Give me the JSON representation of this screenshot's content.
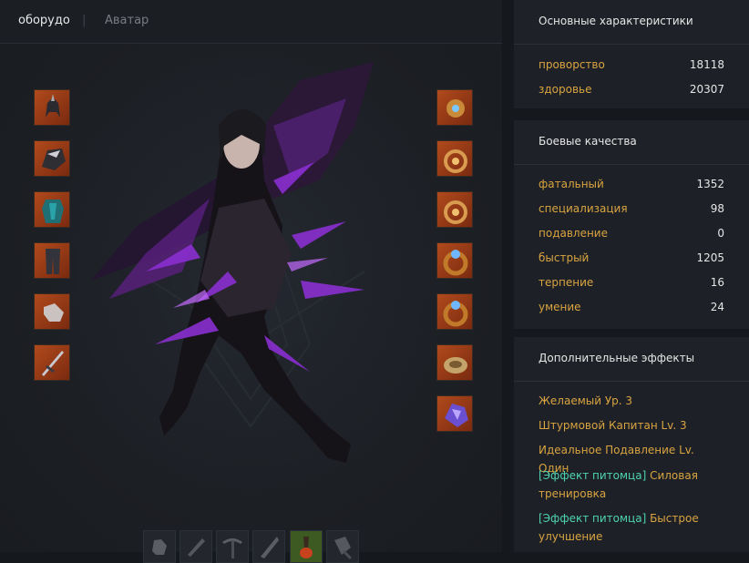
{
  "tabs": {
    "equipment": "оборудо",
    "separator": "|",
    "avatar": "Аватар"
  },
  "left_slots": [
    "helmet-icon",
    "shoulder-armor-icon",
    "chest-armor-icon",
    "pants-icon",
    "gloves-icon",
    "weapon-icon"
  ],
  "right_slots": [
    "earring-icon",
    "necklace-icon",
    "necklace-icon",
    "ring-icon",
    "ring-icon",
    "bracelet-icon",
    "stone-icon"
  ],
  "bottom_slots": [
    "gloves-tool-icon",
    "chisel-tool-icon",
    "pickaxe-tool-icon",
    "knife-tool-icon",
    "scoop-tool-icon",
    "shovel-tool-icon"
  ],
  "basic": {
    "title": "Основные характеристики",
    "rows": [
      {
        "k": "проворство",
        "v": "18118"
      },
      {
        "k": "здоровье",
        "v": "20307"
      }
    ]
  },
  "combat": {
    "title": "Боевые качества",
    "rows": [
      {
        "k": "фатальный",
        "v": "1352"
      },
      {
        "k": "специализация",
        "v": "98"
      },
      {
        "k": "подавление",
        "v": "0"
      },
      {
        "k": "быстрый",
        "v": "1205"
      },
      {
        "k": "терпение",
        "v": "16"
      },
      {
        "k": "умение",
        "v": "24"
      }
    ]
  },
  "extra": {
    "title": "Дополнительные эффекты",
    "effects": [
      "Желаемый Ур. 3",
      "Штурмовой Капитан Lv. 3",
      "Идеальное Подавление Lv. Один"
    ],
    "pet_effects": [
      {
        "tag": "[Эффект питомца]",
        "text": "Силовая тренировка"
      },
      {
        "tag": "[Эффект питомца]",
        "text": "Быстрое улучшение"
      }
    ]
  }
}
